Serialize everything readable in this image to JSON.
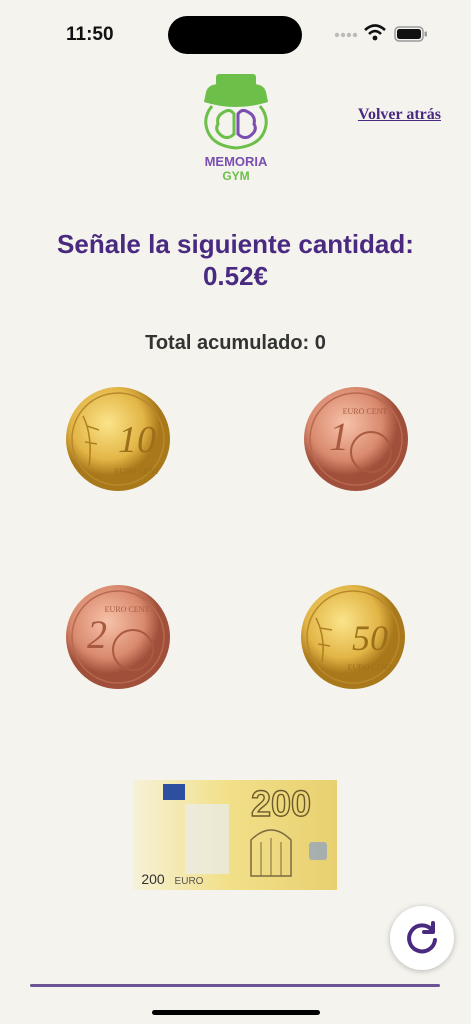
{
  "status_bar": {
    "time": "11:50"
  },
  "header": {
    "logo_line1": "MEMORIA",
    "logo_line2": "GYM",
    "back_label": "Volver atrás"
  },
  "prompt": {
    "line1": "Señale la siguiente cantidad:",
    "amount": "0.52€"
  },
  "total": {
    "label": "Total acumulado:",
    "value": "0"
  },
  "coins": [
    {
      "label": "10",
      "sub": "EURO CENT",
      "type": "gold"
    },
    {
      "label": "1",
      "sub": "EURO CENT",
      "type": "copper"
    },
    {
      "label": "2",
      "sub": "EURO CENT",
      "type": "copper"
    },
    {
      "label": "50",
      "sub": "EURO CENT",
      "type": "gold"
    }
  ],
  "banknote": {
    "value": "200",
    "currency": "EURO"
  },
  "icons": {
    "refresh": "refresh-icon"
  },
  "colors": {
    "accent": "#4a2a80",
    "gold": "#e2b546",
    "copper": "#d98a6e",
    "logo_green": "#6cc04a"
  }
}
